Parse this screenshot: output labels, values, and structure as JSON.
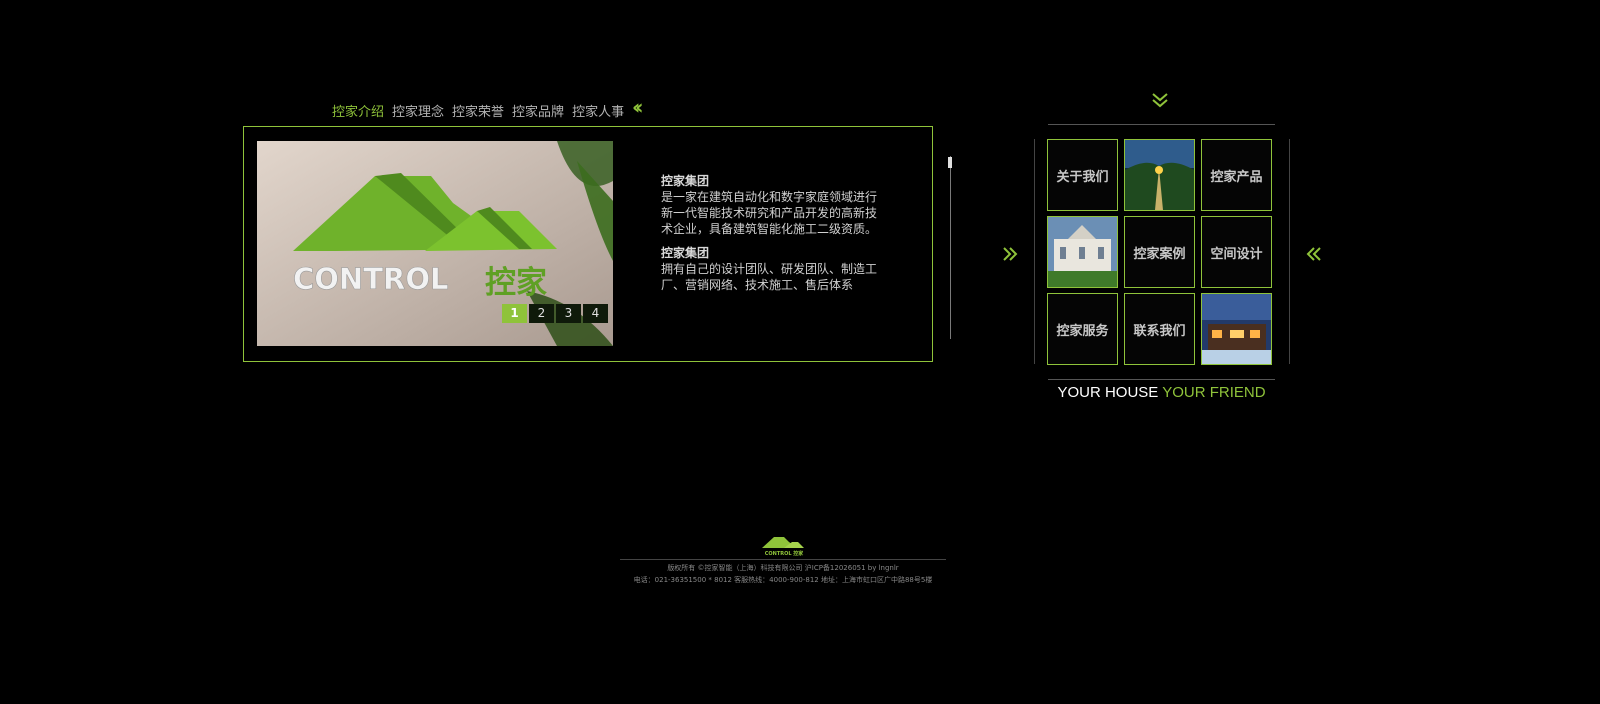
{
  "tabs": [
    "控家介绍",
    "控家理念",
    "控家荣誉",
    "控家品牌",
    "控家人事"
  ],
  "slideshow": {
    "logo_text_en": "CONTROL",
    "logo_text_cn": "控家",
    "pages": [
      "1",
      "2",
      "3",
      "4"
    ],
    "active_page": "1"
  },
  "intro": {
    "title_1": "控家集团",
    "body_1": "是一家在建筑自动化和数字家庭领域进行新一代智能技术研究和产品开发的高新技术企业，具备建筑智能化施工二级资质。",
    "title_2": "控家集团",
    "body_2": "拥有自己的设计团队、研发团队、制造工厂、营销网络、技术施工、售后体系"
  },
  "grid": {
    "about": "关于我们",
    "products": "控家产品",
    "cases": "控家案例",
    "space": "空间设计",
    "service": "控家服务",
    "contact": "联系我们"
  },
  "slogan": {
    "part1": "YOUR HOUSE ",
    "part2": "YOUR FRIEND"
  },
  "footer": {
    "logo_text": "CONTROL 控家",
    "copyright": "版权所有  ©控家智能（上海）科技有限公司  沪ICP备12026051 by lngnlr",
    "contact": "电话：021-36351500 * 8012   客服热线：4000-900-812   地址：上海市虹口区广中路88号5楼"
  },
  "colors": {
    "accent": "#8fc33a",
    "background": "#000000",
    "text": "#b4b4b4"
  },
  "icons": {
    "tabs_arrow": "double-chevron-left-icon",
    "grid_top": "double-chevron-down-icon",
    "grid_left": "double-chevron-right-icon",
    "grid_right": "double-chevron-left-icon"
  }
}
